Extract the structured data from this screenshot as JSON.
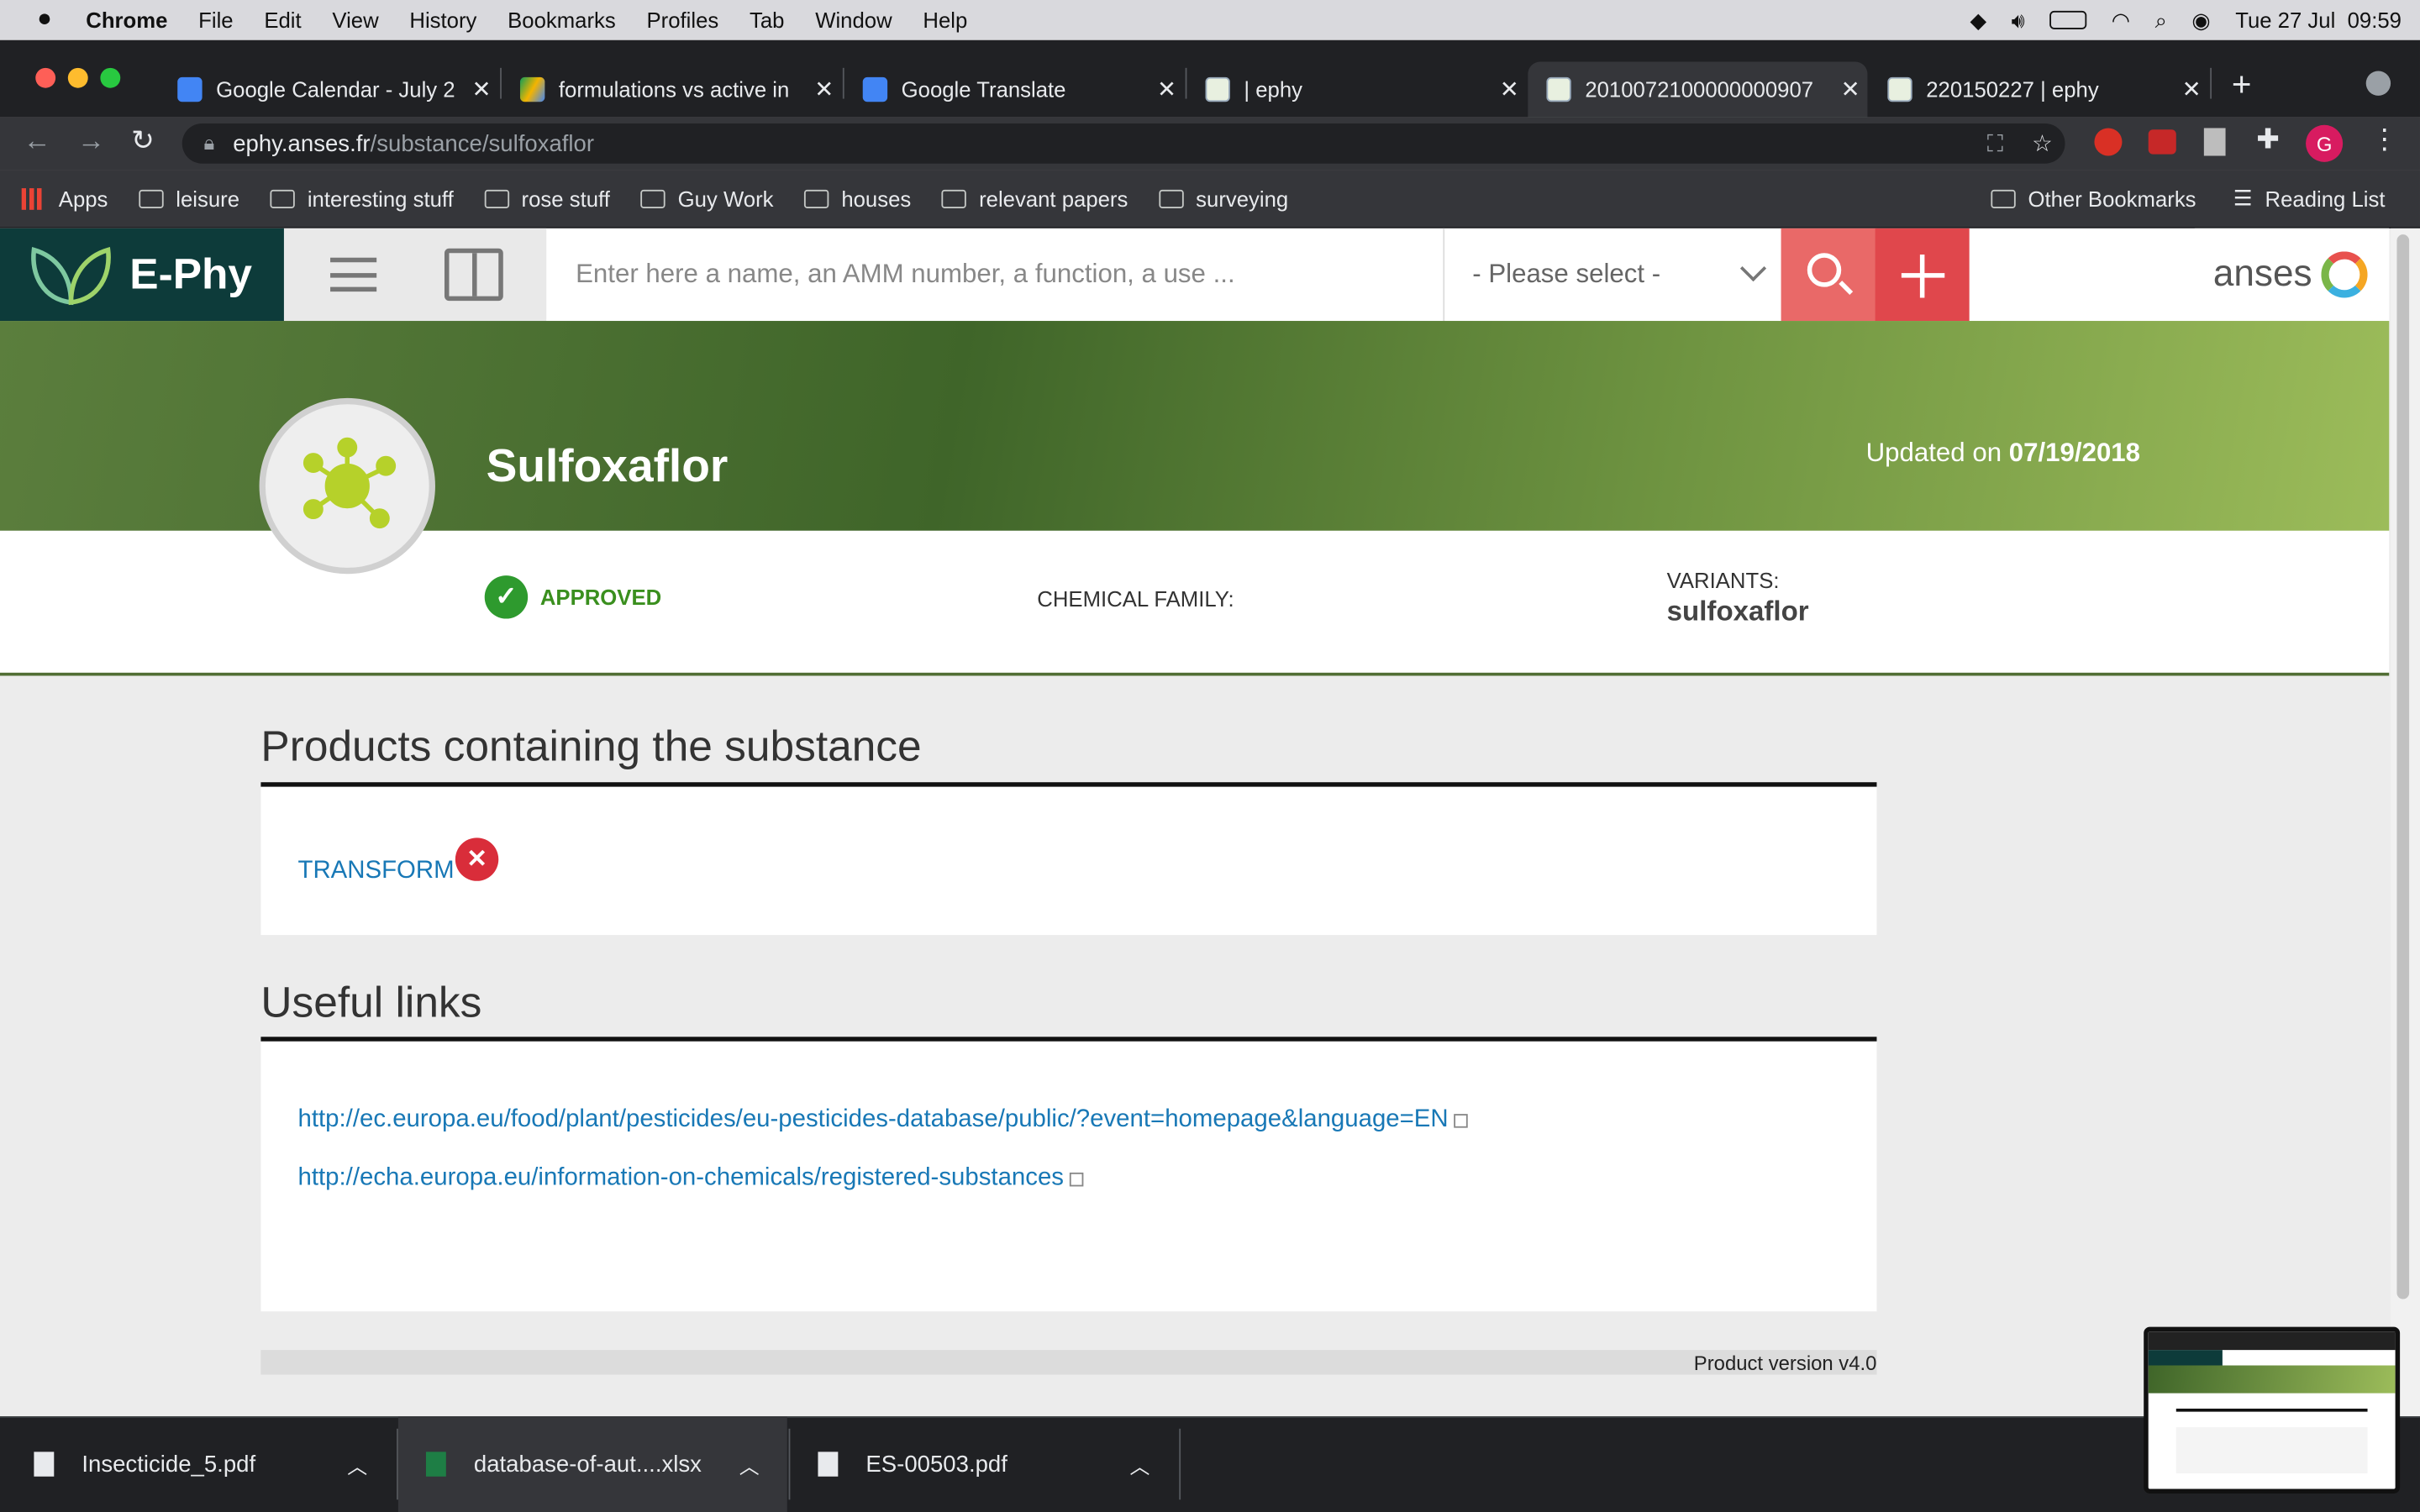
{
  "menubar": {
    "app": "Chrome",
    "items": [
      "File",
      "Edit",
      "View",
      "History",
      "Bookmarks",
      "Profiles",
      "Tab",
      "Window",
      "Help"
    ],
    "datetime": "Tue 27 Jul  09:59"
  },
  "tabs": [
    {
      "title": "Google Calendar - July 2"
    },
    {
      "title": "formulations vs active in"
    },
    {
      "title": "Google Translate"
    },
    {
      "title": "| ephy"
    },
    {
      "title": "2010072100000000907"
    },
    {
      "title": "220150227 | ephy"
    }
  ],
  "address": {
    "domain": "ephy.anses.fr",
    "path": "/substance/sulfoxaflor"
  },
  "profile_initial": "G",
  "bookmarks": {
    "apps": "Apps",
    "items": [
      "leisure",
      "interesting stuff",
      "rose stuff",
      "Guy Work",
      "houses",
      "relevant papers",
      "surveying"
    ],
    "other": "Other Bookmarks",
    "reading": "Reading List"
  },
  "site": {
    "logo": "E-Phy",
    "search_placeholder": "Enter here a name, an AMM number, a function, a use ...",
    "select_value": "- Please select -",
    "anses": "anses",
    "substance": "Sulfoxaflor",
    "updated_label": "Updated on ",
    "updated_date": "07/19/2018",
    "status": "APPROVED",
    "chemical_family_label": "CHEMICAL FAMILY:",
    "variants_label": "VARIANTS:",
    "variants_value": "sulfoxaflor",
    "products_title": "Products containing the substance",
    "product": "TRANSFORM",
    "links_title": "Useful links",
    "links": [
      "http://ec.europa.eu/food/plant/pesticides/eu-pesticides-database/public/?event=homepage&language=EN",
      "http://echa.europa.eu/information-on-chemicals/registered-substances"
    ],
    "version": "Product version v4.0"
  },
  "downloads": [
    {
      "name": "Insecticide_5.pdf"
    },
    {
      "name": "database-of-aut....xlsx"
    },
    {
      "name": "ES-00503.pdf"
    }
  ],
  "colors": {
    "accent_red": "#e0474c",
    "link": "#1878b6",
    "approved": "#2e9a2e",
    "reject": "#d92d3a"
  }
}
